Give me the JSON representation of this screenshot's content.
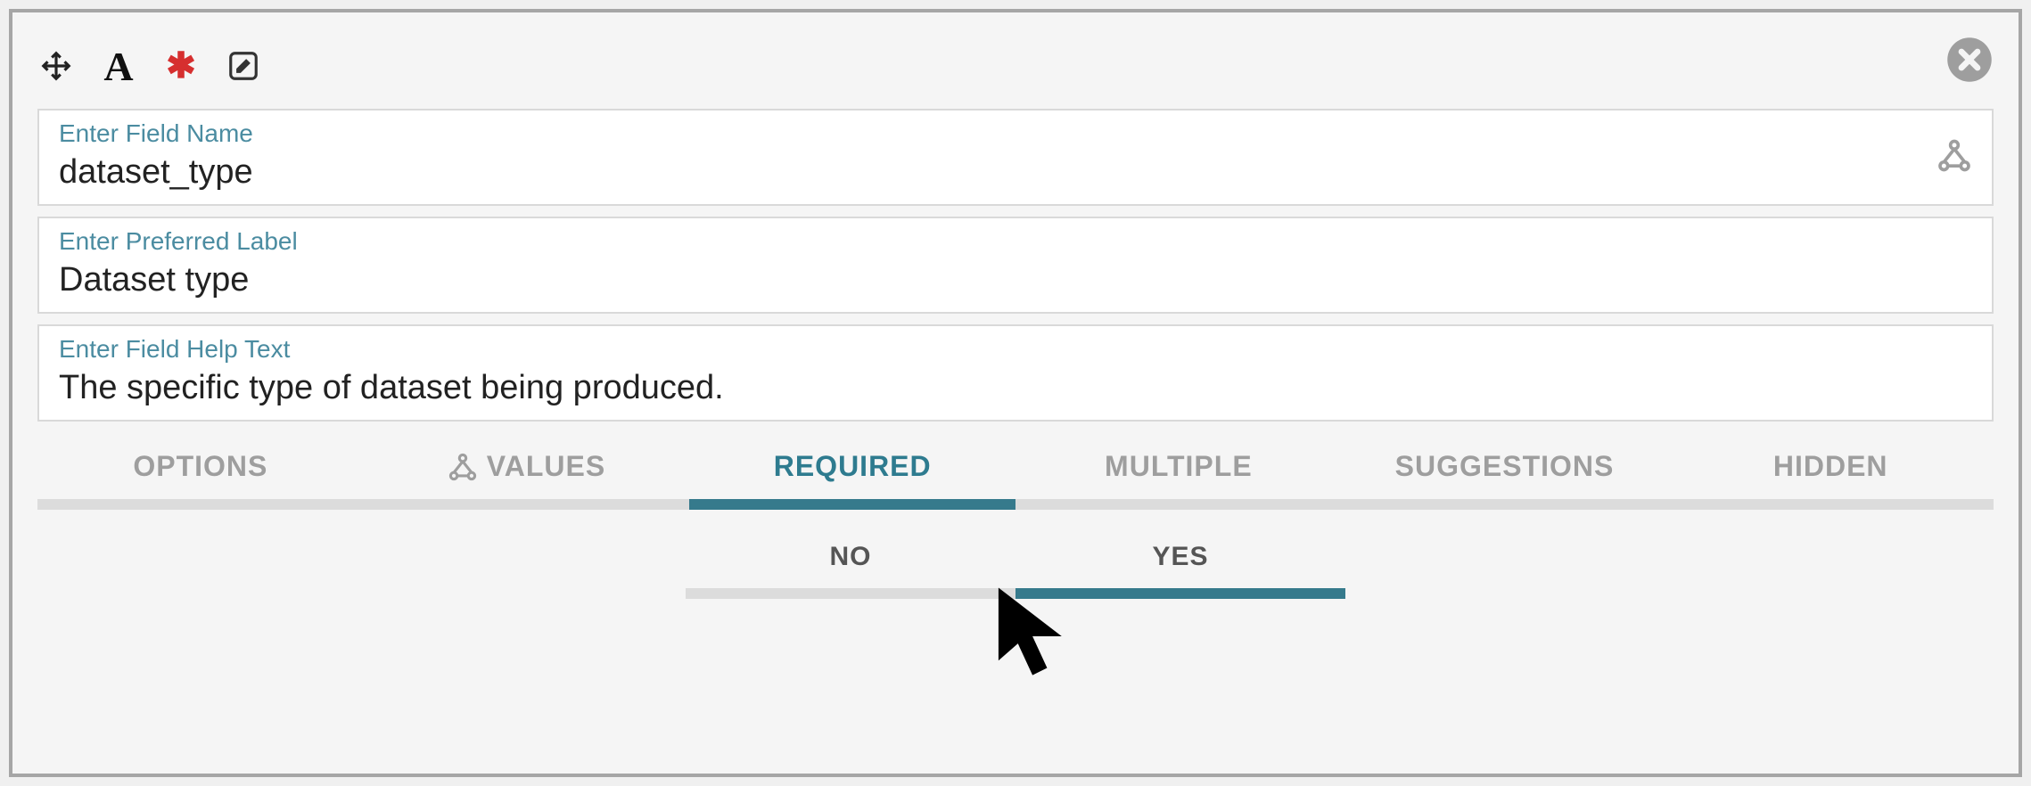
{
  "toolbar": {
    "icons": {
      "move": "move-icon",
      "font": "font-icon",
      "required": "asterisk-icon",
      "edit": "edit-icon"
    }
  },
  "fields": {
    "name": {
      "label": "Enter Field Name",
      "value": "dataset_type"
    },
    "pref": {
      "label": "Enter Preferred Label",
      "value": "Dataset type"
    },
    "help": {
      "label": "Enter Field Help Text",
      "value": "The specific type of dataset being produced."
    }
  },
  "tabs": {
    "items": [
      {
        "label": "OPTIONS"
      },
      {
        "label": "VALUES"
      },
      {
        "label": "REQUIRED"
      },
      {
        "label": "MULTIPLE"
      },
      {
        "label": "SUGGESTIONS"
      },
      {
        "label": "HIDDEN"
      }
    ],
    "active_index": 2
  },
  "required_toggle": {
    "options": [
      {
        "label": "NO"
      },
      {
        "label": "YES"
      }
    ],
    "active_index": 1
  },
  "colors": {
    "accent": "#367a8c",
    "label": "#4b8ca1",
    "muted": "#9e9e9e"
  }
}
